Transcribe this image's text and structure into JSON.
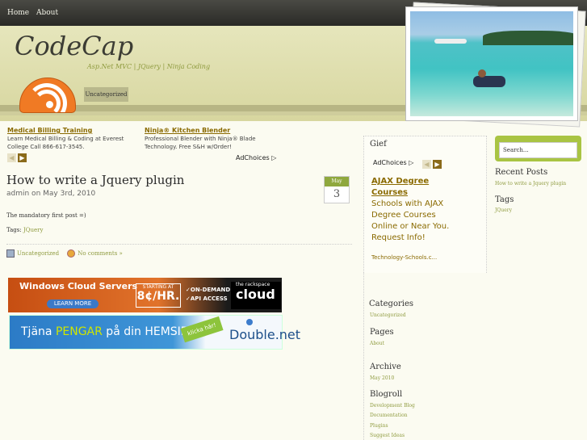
{
  "nav": {
    "home": "Home",
    "about": "About"
  },
  "header": {
    "title": "CodeCap",
    "tagline": "Asp.Net MVC | JQuery | Ninja Coding",
    "category_tab": "Uncategorized"
  },
  "ads": {
    "items": [
      {
        "title": "Medical Billing Training",
        "desc": "Learn Medical Billing & Coding at Everest College Call 866-617-3545."
      },
      {
        "title": "Ninja® Kitchen Blender",
        "desc": "Professional Blender with Ninja® Blade Technology. Free S&H w/Order!"
      }
    ],
    "adchoices": "AdChoices ▷"
  },
  "post": {
    "title": "How to write a Jquery plugin",
    "meta": "admin on May 3rd, 2010",
    "date_month": "May",
    "date_day": "3",
    "body": "The mandatory first post =)",
    "tags_label": "Tags: ",
    "tag": "JQuery",
    "category": "Uncategorized",
    "comments": "No comments »"
  },
  "banners": {
    "rackspace": {
      "title": "Windows Cloud Servers",
      "learn": "LEARN MORE",
      "starting": "STARTING AT",
      "price": "8¢/HR.",
      "feat1": "✓ON-DEMAND",
      "feat2": "✓API ACCESS",
      "brand_small": "the rackspace",
      "brand_big": "cloud"
    },
    "double": {
      "text_a": "Tjäna ",
      "text_b": "PENGAR",
      "text_c": " på din HEMSIDA!",
      "klicka": "klicka här!",
      "logo": "Double.net"
    }
  },
  "midbar": {
    "gief": "Gief",
    "adchoices": "AdChoices ▷",
    "ad_title": "AJAX Degree Courses",
    "ad_desc": "Schools with AJAX Degree Courses Online or Near You. Request Info!",
    "ad_src": "Technology-Schools.c...",
    "categories_h": "Categories",
    "categories": [
      "Uncategorized"
    ],
    "pages_h": "Pages",
    "pages": [
      "About"
    ],
    "archive_h": "Archive",
    "archive": [
      "May 2010"
    ],
    "blogroll_h": "Blogroll",
    "blogroll": [
      "Development Blog",
      "Documentation",
      "Plugins",
      "Suggest Ideas"
    ]
  },
  "rightbar": {
    "search_value": "Search...",
    "recent_h": "Recent Posts",
    "recent": [
      "How to write a Jquery plugin"
    ],
    "tags_h": "Tags",
    "tags": [
      "JQuery"
    ]
  }
}
